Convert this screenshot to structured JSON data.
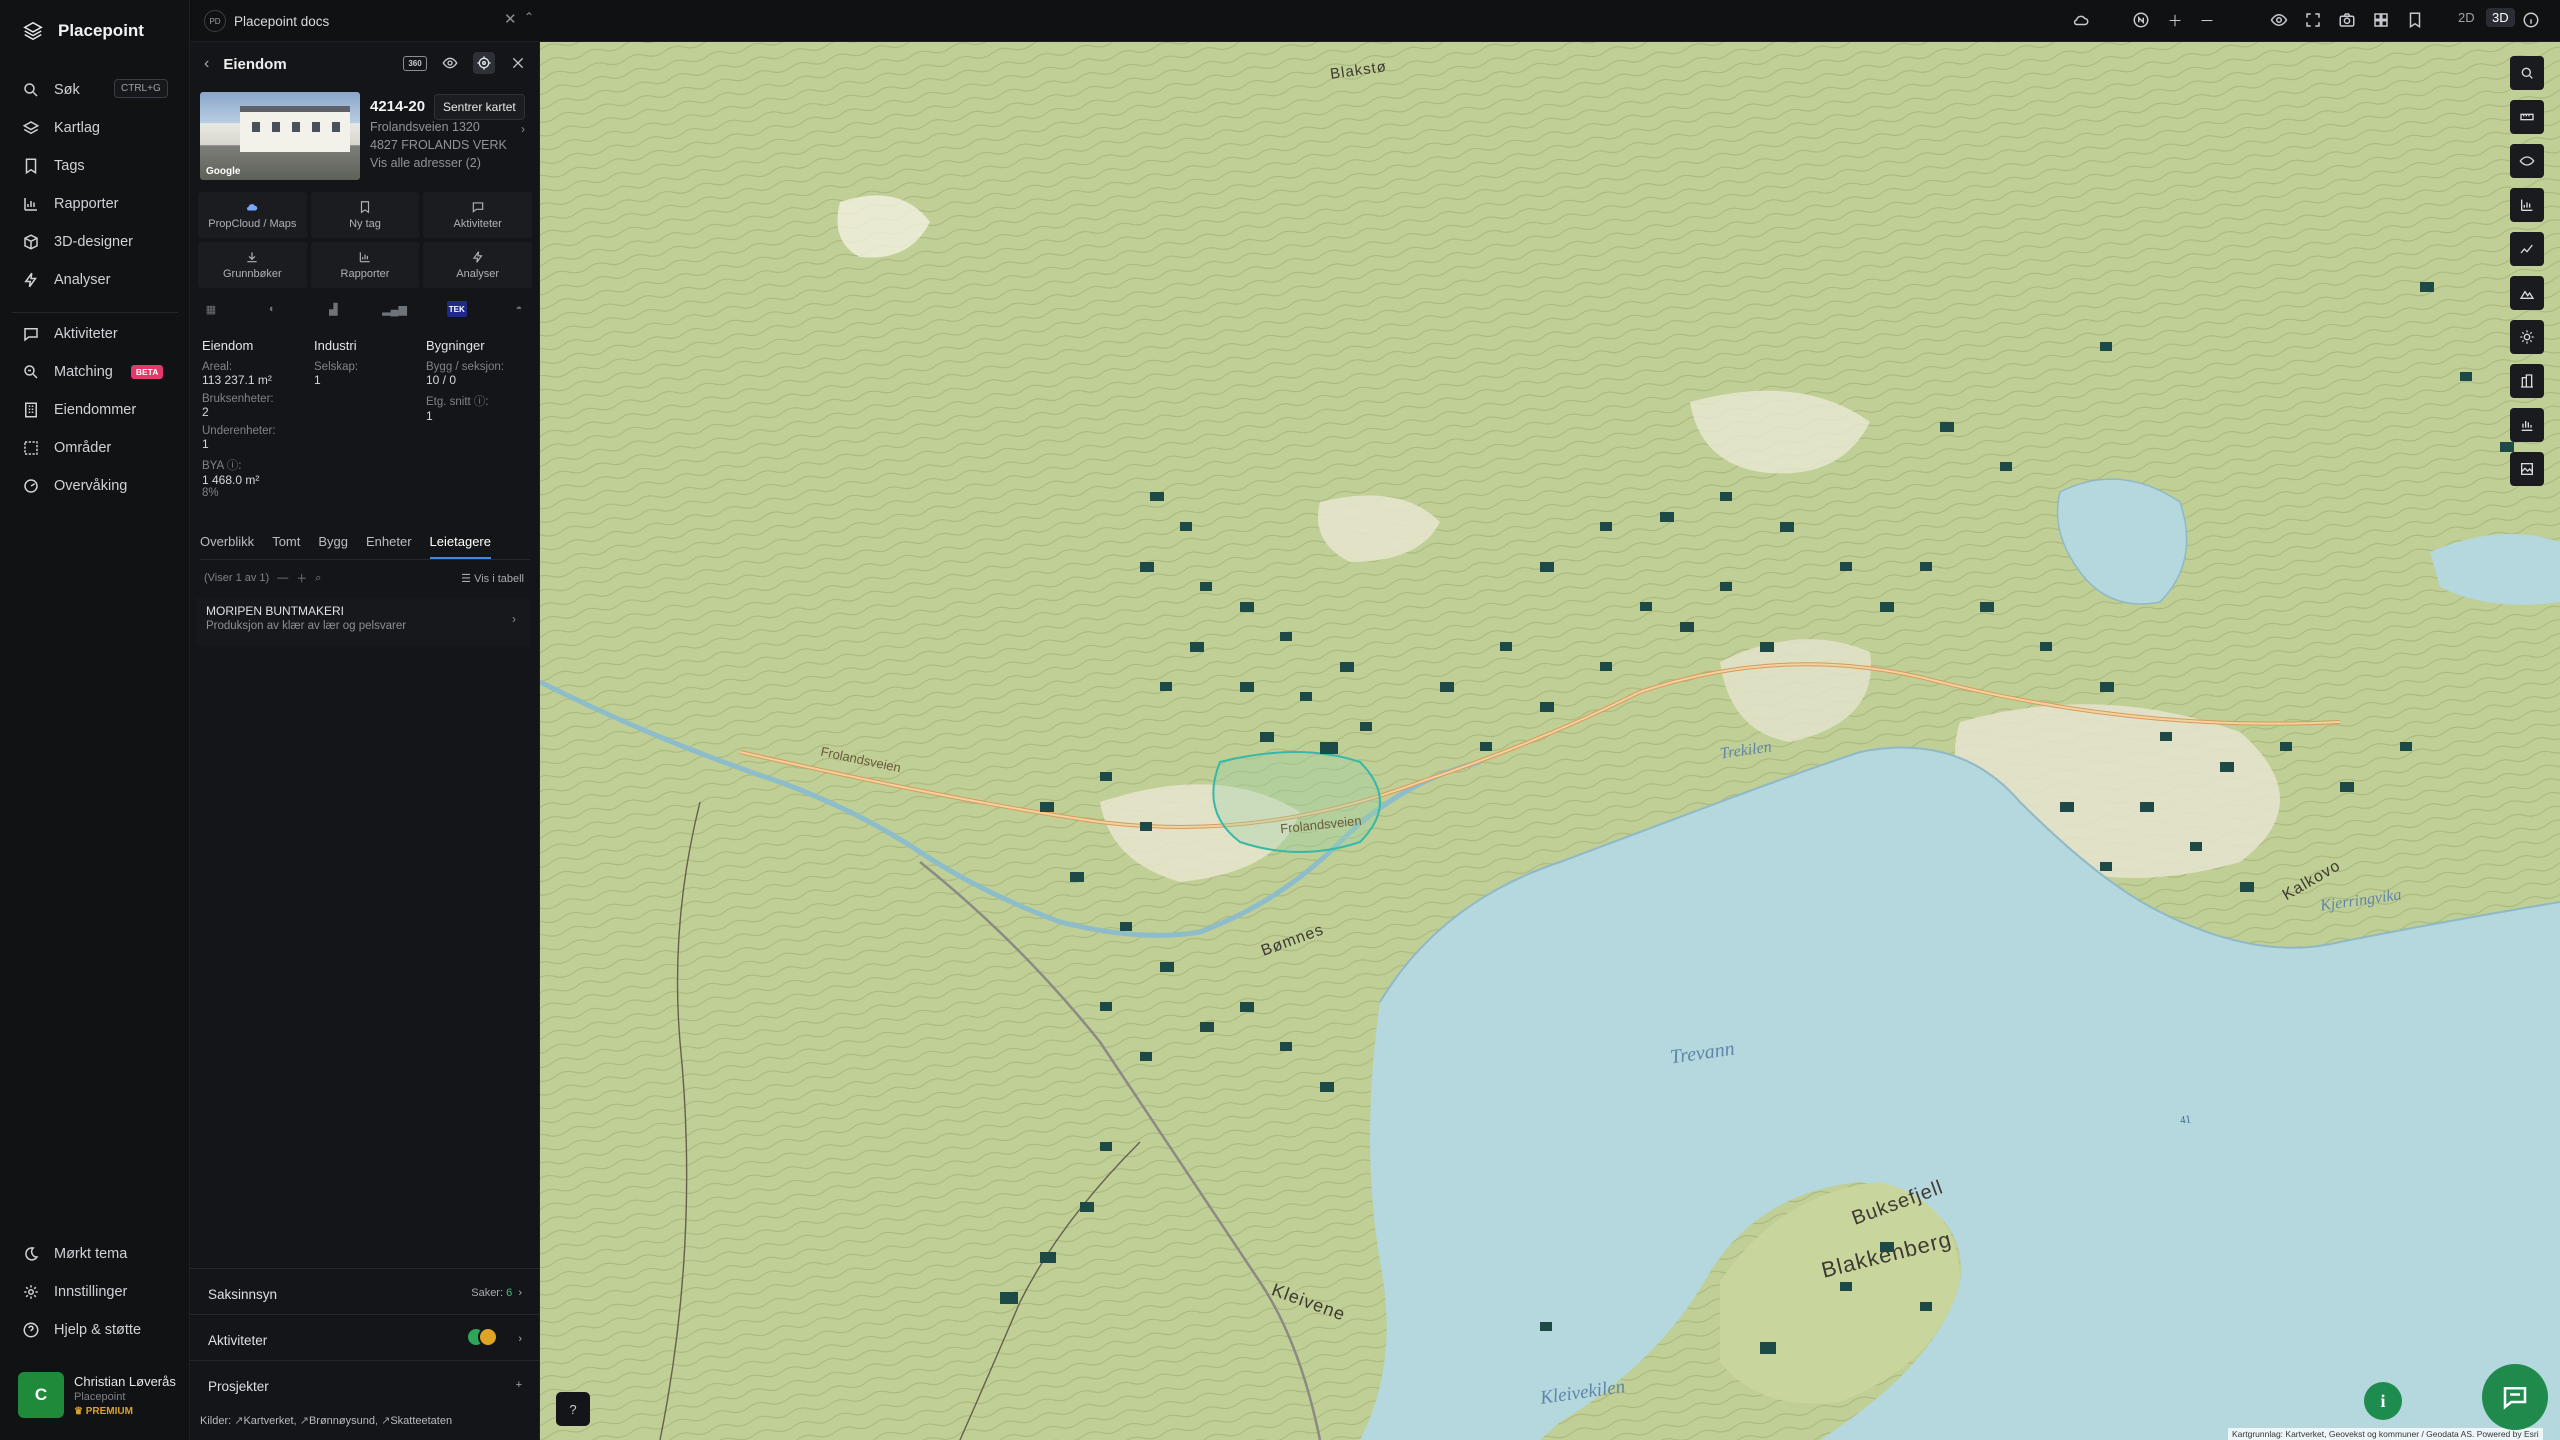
{
  "app": {
    "name": "Placepoint"
  },
  "nav": {
    "items": [
      {
        "label": "Søk",
        "shortcut": "CTRL+G"
      },
      {
        "label": "Kartlag"
      },
      {
        "label": "Tags"
      },
      {
        "label": "Rapporter"
      },
      {
        "label": "3D-designer"
      },
      {
        "label": "Analyser"
      },
      {
        "label": "Aktiviteter"
      },
      {
        "label": "Matching",
        "badge": "BETA"
      },
      {
        "label": "Eiendommer"
      },
      {
        "label": "Områder"
      },
      {
        "label": "Overvåking"
      }
    ],
    "bottom": [
      {
        "label": "Mørkt tema"
      },
      {
        "label": "Innstillinger"
      },
      {
        "label": "Hjelp & støtte"
      }
    ],
    "user": {
      "initial": "C",
      "name": "Christian Løverås",
      "org": "Placepoint",
      "tier": "PREMIUM"
    }
  },
  "topbar": {
    "workspace": {
      "abbr": "PD",
      "title": "Placepoint docs"
    },
    "modes": {
      "two_d": "2D",
      "three_d": "3D",
      "active": "3D"
    }
  },
  "panel": {
    "title": "Eiendom",
    "badge_360": "360",
    "tooltip": "Sentrer kartet",
    "photo_credit": "Google",
    "property": {
      "id": "4214-20",
      "street": "Frolandsveien 1320",
      "postal": "4827 FROLANDS VERK",
      "all_addresses": "Vis alle adresser (2)"
    },
    "actions": [
      "PropCloud / Maps",
      "Ny tag",
      "Aktiviteter",
      "Grunnbøker",
      "Rapporter",
      "Analyser"
    ],
    "tek_badge": "TEK",
    "stats": {
      "eiendom": {
        "title": "Eiendom",
        "areal_label": "Areal:",
        "areal_value": "113 237.1",
        "areal_unit": "m²",
        "bruks_label": "Bruksenheter:",
        "bruks_value": "2",
        "under_label": "Underenheter:",
        "under_value": "1",
        "bya_label": "BYA ⓘ:",
        "bya_value": "1 468.0",
        "bya_unit": "m²",
        "bya_pct": "8%"
      },
      "industri": {
        "title": "Industri",
        "selskap_label": "Selskap:",
        "selskap_value": "1"
      },
      "bygninger": {
        "title": "Bygninger",
        "bygg_label": "Bygg / seksjon:",
        "bygg_value": "10 / 0",
        "etg_label": "Etg. snitt ⓘ:",
        "etg_value": "1"
      }
    },
    "tabs": [
      "Overblikk",
      "Tomt",
      "Bygg",
      "Enheter",
      "Leietagere"
    ],
    "active_tab": "Leietagere",
    "list": {
      "count_text": "(Viser 1 av 1)",
      "view_table": "Vis i tabell",
      "rows": [
        {
          "name": "MORIPEN BUNTMAKERI",
          "desc": "Produksjon av klær av lær og pelsvarer"
        }
      ]
    },
    "sections": {
      "saksinnsyn": {
        "label": "Saksinnsyn",
        "count_label": "Saker:",
        "count": "6"
      },
      "aktiviteter": {
        "label": "Aktiviteter"
      },
      "prosjekter": {
        "label": "Prosjekter",
        "add": "+"
      }
    },
    "sources": {
      "label": "Kilder:",
      "items": [
        "Kartverket",
        "Brønnøysund",
        "Skatteetaten"
      ]
    }
  },
  "map": {
    "labels": {
      "lake": "Trevann",
      "bay": "Kleivekilen",
      "cove1": "Trekilen",
      "cove2": "Kjerringvika",
      "road1": "Frolandsveien",
      "road2": "Frolandsveien",
      "place1": "Blakkenberg",
      "place2": "Buksefjell",
      "place3": "Bømnes",
      "place4": "Kleivene",
      "place5": "Blakstø",
      "place6": "Kalkovo",
      "elev": "41"
    },
    "attribution": "Kartgrunnlag: Kartverket, Geovekst og kommuner / Geodata AS. Powered by Esri"
  },
  "colors": {
    "accent": "#3f8ae0",
    "brand_green": "#1f8a4c",
    "water": "#b5d7de",
    "terrain": "#bfcf95"
  }
}
